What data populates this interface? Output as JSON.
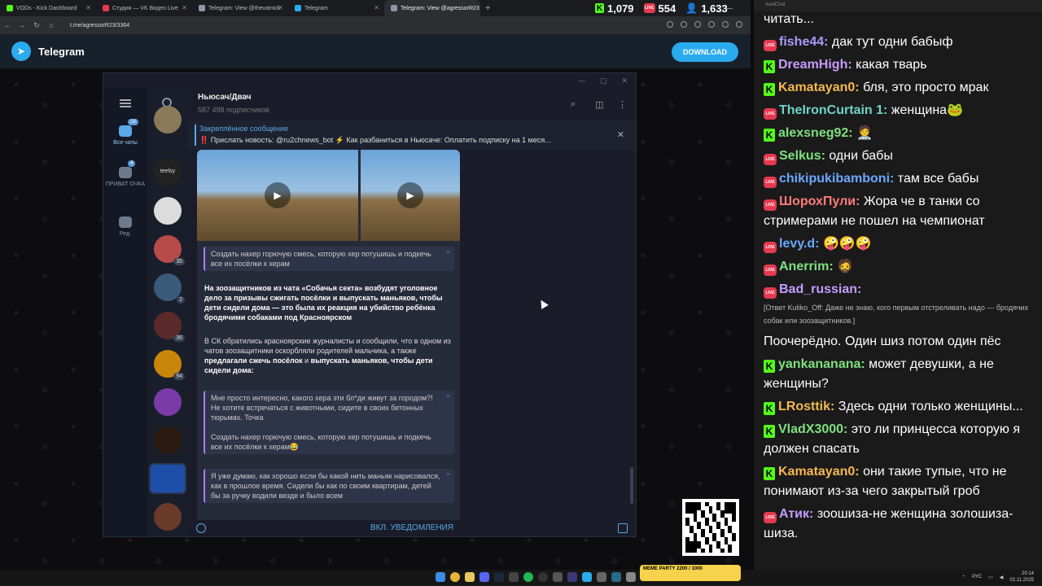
{
  "browser": {
    "tabs": [
      {
        "label": "VODs - Kick Dashboard",
        "color": "#53fc18"
      },
      {
        "label": "Студия — VK Видео Live",
        "color": "#e63950"
      },
      {
        "label": "Telegram: View @thevatnick",
        "color": "#8b96a8"
      },
      {
        "label": "Telegram",
        "color": "#2aabee"
      },
      {
        "label": "Telegram: View @agressorR23",
        "color": "#8b96a8"
      }
    ],
    "new_tab": "+",
    "url": "t.me/agressorR23/3364"
  },
  "stream_stats": {
    "kick_viewers": "1,079",
    "vk_viewers": "554",
    "total_viewers": "1,633"
  },
  "telegram_web": {
    "brand": "Telegram",
    "download_label": "DOWNLOAD"
  },
  "tg_app": {
    "rail": [
      {
        "label": "Все чаты",
        "badge": "18"
      },
      {
        "label": "ПРИВАТ ОЧКА",
        "badge": "4"
      },
      {
        "label": "Ред.",
        "badge": ""
      }
    ],
    "chat_list": [
      {
        "color": "#8a7a5a",
        "badge": ""
      },
      {
        "color": "#222",
        "badge": "",
        "text": "teelsy"
      },
      {
        "color": "#dcdcdc",
        "badge": ""
      },
      {
        "color": "#b84a4a",
        "badge": "35"
      },
      {
        "color": "#3a5a7a",
        "badge": "2"
      },
      {
        "color": "#5a2a2a",
        "badge": "36"
      },
      {
        "color": "#c8860a",
        "badge": "94"
      },
      {
        "color": "#7a3aa8",
        "badge": ""
      },
      {
        "color": "#2a1a10",
        "badge": ""
      },
      {
        "color": "#1e4fa8",
        "badge": ""
      },
      {
        "color": "#6a3a2a",
        "badge": ""
      },
      {
        "color": "#2a7ad8",
        "badge": ""
      }
    ],
    "chat": {
      "name": "Ньюсач/Двач",
      "subscribers": "587 498 подписчиков",
      "pinned_title": "Закреплённое сообщение",
      "pinned_text": "‼️ Прислать новость: @ru2chnews_bot ⚡ Как разбаниться в Ньюсаче:   Оплатить подписку на 1 меся...",
      "quote1": "Создать нахер горючую смесь, которую хер потушишь и подкечь все их посёлки к херам",
      "headline": "На зоозащитников из чата «Собачья секта» возбудят уголовное дело за призывы сжигать посёлки и выпускать маньяков, чтобы дети сидели дома — это была их реакция на убийство ребёнка бродячими собаками под Красноярском",
      "body_a": "В СК обратились красноярские журналисты и сообщили, что в одном из чатов зоозащитники оскорбляли родителей мальчика, а также ",
      "body_b": "предлагали сжечь посёлок",
      "body_c": " и ",
      "body_d": "выпускать маньяков, чтобы дети сидели дома:",
      "quote2a": "Мне просто интересно, какого хера эти бл*ди живут за городом?! Не хотите встречаться с животными, сидите в своих бетонных тюрьмах. Точка",
      "quote2b": "Создать нахер горючую смесь, которую хер потушишь и подкечь все их посёлки к херам😂",
      "quote3": "Я уже думаю, как хорошо если бы какой нить маньяк нарисовался, как в прошлое время. Сидели бы как по своим квартирам, детей бы за ручку водили везде и было всем",
      "notifications_label": "ВКЛ. УВЕДОМЛЕНИЯ"
    }
  },
  "chat_panel": {
    "title": "AxelChat",
    "messages": [
      {
        "platform": "",
        "user": "",
        "color": "#fff",
        "text": "читать..."
      },
      {
        "platform": "vk",
        "user": "fishe44:",
        "color": "#a99bff",
        "text": "дак тут одни бабыф"
      },
      {
        "platform": "kick",
        "user": "DreamHigh:",
        "color": "#c79bff",
        "text": "какая тварь"
      },
      {
        "platform": "kick",
        "user": "Kamatayan0:",
        "color": "#f4b850",
        "text": "бля, это просто мрак"
      },
      {
        "platform": "vk",
        "user": "TheIronCurtain 1:",
        "color": "#6fd4c8",
        "text": "женщина🐸"
      },
      {
        "platform": "kick",
        "user": "alexsneg92:",
        "color": "#7fe07f",
        "text": "🧑‍⚕️"
      },
      {
        "platform": "vk",
        "user": "Selkus:",
        "color": "#7fe07f",
        "text": "одни бабы"
      },
      {
        "platform": "vk",
        "user": "chikipukibamboni:",
        "color": "#6aa8ff",
        "text": "там все бабы"
      },
      {
        "platform": "vk",
        "user": "ШорохПули:",
        "color": "#ff7a7a",
        "text": "Жора че в танки со стримерами не пошел на чемпионат"
      },
      {
        "platform": "vk",
        "user": "levy.d:",
        "color": "#6aa8ff",
        "text": "🤪🤪🤪"
      },
      {
        "platform": "vk",
        "user": "Anerrim:",
        "color": "#7fe07f",
        "text": "🧔"
      },
      {
        "platform": "vk",
        "user": "Bad_russian:",
        "color": "#c79bff",
        "text": ""
      },
      {
        "platform": "reply",
        "user": "",
        "color": "#fff",
        "text": "[Ответ Kuliko_Off: Даже не знаю, кого первым отстреливать надо — бродячих собак или зоозащитников.]"
      },
      {
        "platform": "",
        "user": "",
        "color": "#fff",
        "text": "Поочерёдно. Один шиз потом один пёс"
      },
      {
        "platform": "kick",
        "user": "yankananana:",
        "color": "#7fe07f",
        "text": "может девушки, а не женщины?"
      },
      {
        "platform": "kick",
        "user": "LRosttik:",
        "color": "#f4b850",
        "text": "Здесь одни только женщины..."
      },
      {
        "platform": "kick",
        "user": "VladX3000:",
        "color": "#7fe07f",
        "text": "это ли принцесса которую я должен спасать"
      },
      {
        "platform": "kick",
        "user": "Kamatayan0:",
        "color": "#f4b850",
        "text": "они такие тупые, что не понимают из-за чего закрытый гроб"
      },
      {
        "platform": "vk",
        "user": "Атик:",
        "color": "#c79bff",
        "text": "зоошиза-не женщина золошиза-шиза."
      }
    ]
  },
  "taskbar": {
    "lang": "РУС",
    "time": "20:14",
    "date": "02.11.2025",
    "meme_party": "MEME PARTY",
    "meme_counts": "2200 / 1000"
  }
}
